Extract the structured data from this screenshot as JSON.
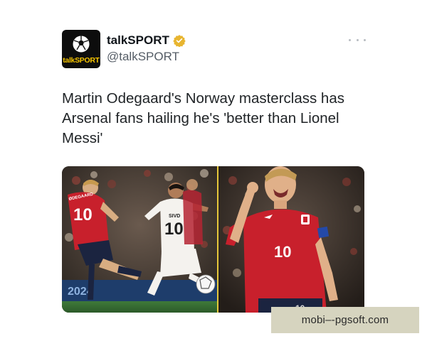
{
  "account": {
    "display_name": "talkSPORT",
    "handle": "@talkSPORT",
    "avatar_word": "talkSPORT",
    "verified": true,
    "verified_badge_color": "#e8b530"
  },
  "tweet": {
    "text": "Martin Odegaard's Norway masterclass has Arsenal fans hailing he's 'better than Lionel Messi'"
  },
  "media": {
    "left_photo": {
      "norway_shirt_number": "10",
      "norway_shirt_name": "ØDEGAARD",
      "georgia_shirt_number": "10",
      "georgia_shirt_name": "SIVD",
      "board_text": "2024"
    },
    "right_photo": {
      "shirt_number": "10",
      "shorts_number": "10"
    },
    "divider_color": "#e6c83a"
  },
  "watermark": {
    "text": "mobi–-pgsoft.com"
  },
  "colors": {
    "norway_red": "#c8202c",
    "text": "#0f1419",
    "muted": "#555d66"
  }
}
